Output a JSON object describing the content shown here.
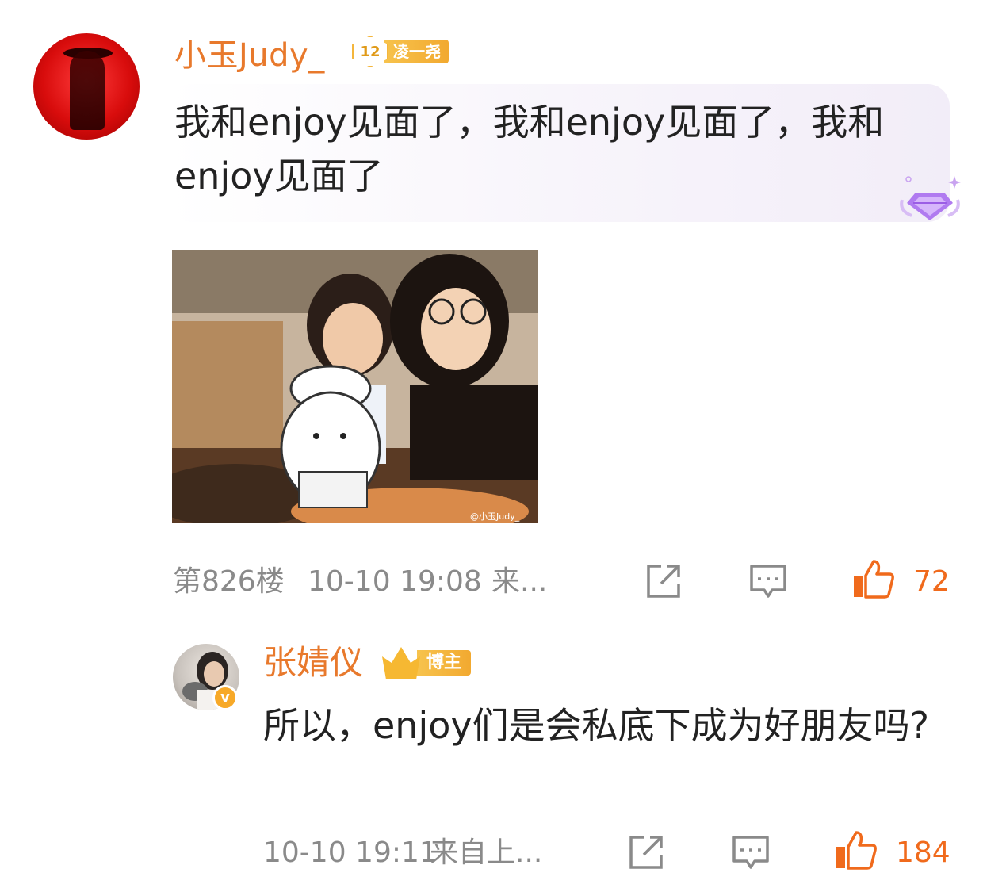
{
  "comment": {
    "username": "小玉Judy_",
    "fan_level": "12",
    "fan_badge_name": "凌一尧",
    "text": "我和enjoy见面了，我和enjoy见面了，我和enjoy见面了",
    "image_watermark": "@小玉Judy_",
    "floor": "第826楼",
    "time": "10-10 19:08",
    "source": "来...",
    "like_count": "72",
    "icons": [
      "share-icon",
      "comment-icon",
      "like-icon",
      "gem-badge-icon"
    ]
  },
  "reply": {
    "username": "张婧仪",
    "verified_badge": "v",
    "blogger_badge": "博主",
    "text": "所以，enjoy们是会私底下成为好朋友吗?",
    "time": "10-10 19:11",
    "source": "来自上...",
    "like_count": "184",
    "icons": [
      "share-icon",
      "comment-icon",
      "like-icon"
    ]
  },
  "colors": {
    "username": "#e8792c",
    "like_active": "#f06a1c",
    "meta_gray": "#8a8a8a",
    "badge_gold": "#f2a930"
  }
}
